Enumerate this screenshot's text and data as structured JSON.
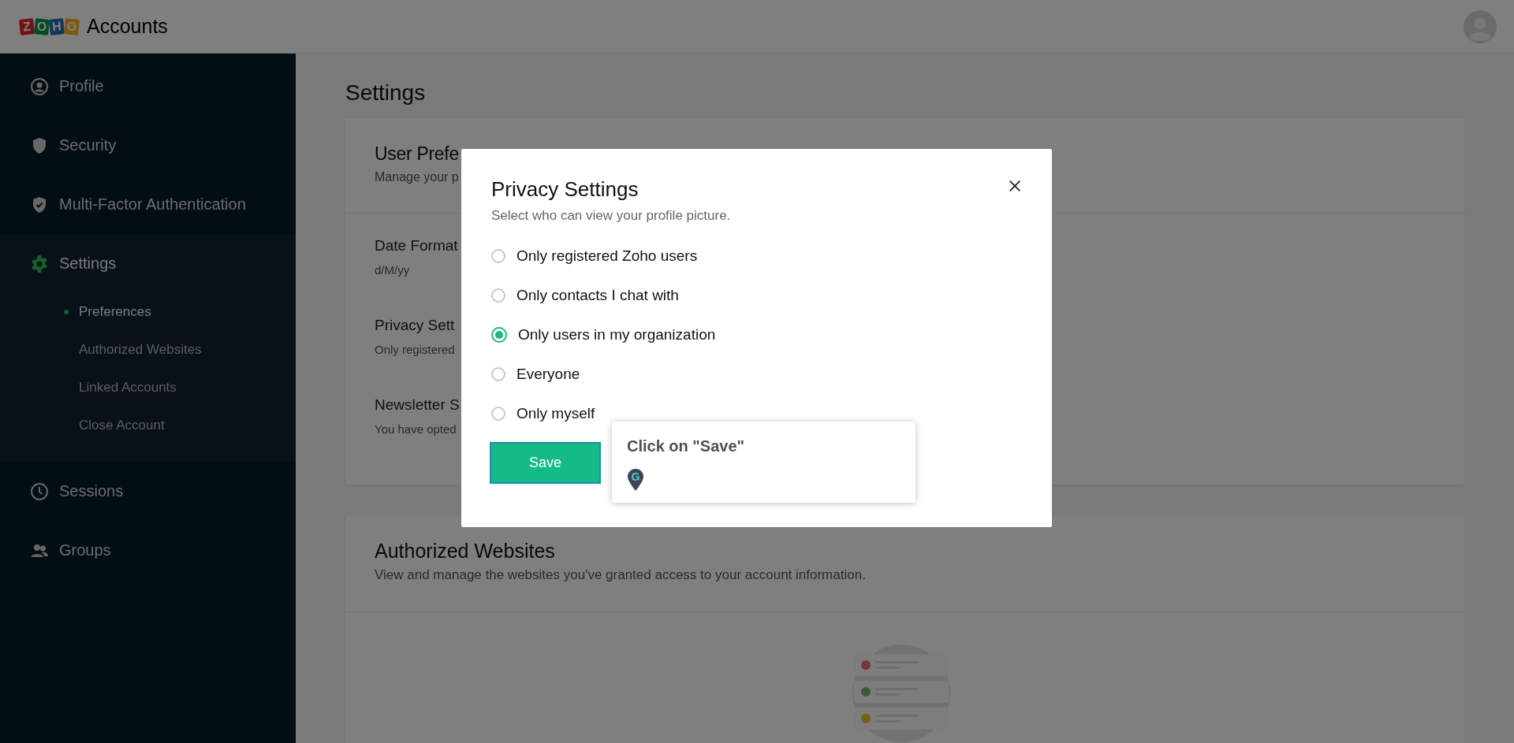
{
  "header": {
    "logo_letters": [
      "Z",
      "O",
      "H",
      "O"
    ],
    "brand": "Accounts"
  },
  "sidebar": {
    "items": [
      {
        "label": "Profile",
        "selected": false
      },
      {
        "label": "Security",
        "selected": false
      },
      {
        "label": "Multi-Factor Authentication",
        "selected": false
      },
      {
        "label": "Settings",
        "selected": true,
        "children": [
          {
            "label": "Preferences",
            "selected": true
          },
          {
            "label": "Authorized Websites",
            "selected": false
          },
          {
            "label": "Linked Accounts",
            "selected": false
          },
          {
            "label": "Close Account",
            "selected": false
          }
        ]
      },
      {
        "label": "Sessions",
        "selected": false
      },
      {
        "label": "Groups",
        "selected": false
      }
    ]
  },
  "page": {
    "title": "Settings",
    "preferences_card": {
      "title": "User Prefe",
      "subtitle": "Manage your p",
      "rows": [
        {
          "label": "Date Format",
          "value": "d/M/yy"
        },
        {
          "label": "Privacy Sett",
          "value": "Only registered"
        },
        {
          "label": "Newsletter S",
          "value": "You have opted"
        }
      ]
    },
    "websites_card": {
      "title": "Authorized Websites",
      "subtitle": "View and manage the websites you've granted access to your account information."
    }
  },
  "modal": {
    "title": "Privacy Settings",
    "subtitle": "Select who can view your profile picture.",
    "options": [
      {
        "label": "Only registered Zoho users",
        "selected": false
      },
      {
        "label": "Only contacts I chat with",
        "selected": false
      },
      {
        "label": "Only users in my organization",
        "selected": true
      },
      {
        "label": "Everyone",
        "selected": false
      },
      {
        "label": "Only myself",
        "selected": false
      }
    ],
    "save_button": "Save"
  },
  "tooltip": {
    "text": "Click on \"Save\"",
    "pin_letter": "G"
  }
}
